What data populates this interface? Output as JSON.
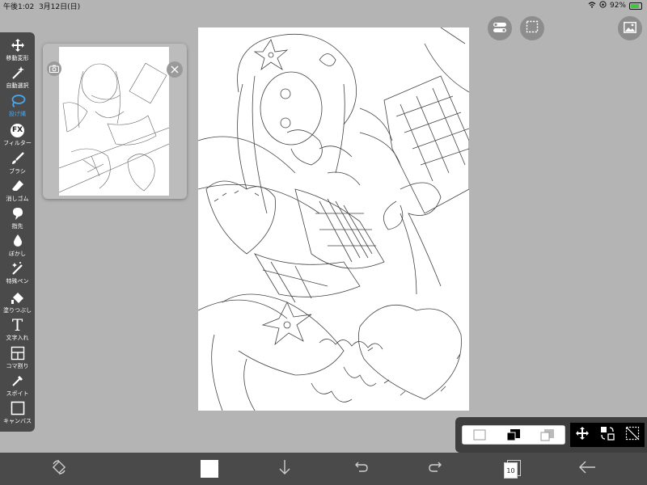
{
  "status": {
    "time": "午後1:02",
    "date": "3月12日(日)",
    "battery": "92%"
  },
  "toolbar": {
    "items": [
      {
        "id": "move",
        "label": "移動変形"
      },
      {
        "id": "wand",
        "label": "自動選択"
      },
      {
        "id": "lasso",
        "label": "投げ縄"
      },
      {
        "id": "filter",
        "label": "フィルター",
        "icon_text": "FX"
      },
      {
        "id": "brush",
        "label": "ブラシ"
      },
      {
        "id": "eraser",
        "label": "消しゴム"
      },
      {
        "id": "finger",
        "label": "指先"
      },
      {
        "id": "blur",
        "label": "ぼかし"
      },
      {
        "id": "special",
        "label": "特殊ペン"
      },
      {
        "id": "fill",
        "label": "塗りつぶし"
      },
      {
        "id": "text",
        "label": "文字入れ",
        "icon_text": "T"
      },
      {
        "id": "frame",
        "label": "コマ割り"
      },
      {
        "id": "eyedropper",
        "label": "スポイト"
      },
      {
        "id": "canvas",
        "label": "キャンバス"
      }
    ],
    "active": "lasso"
  },
  "bottom": {
    "layer_count": "10"
  },
  "colors": {
    "accent": "#48a8f0",
    "toolbar": "#4a4a4a",
    "background": "#b4b4b4"
  }
}
